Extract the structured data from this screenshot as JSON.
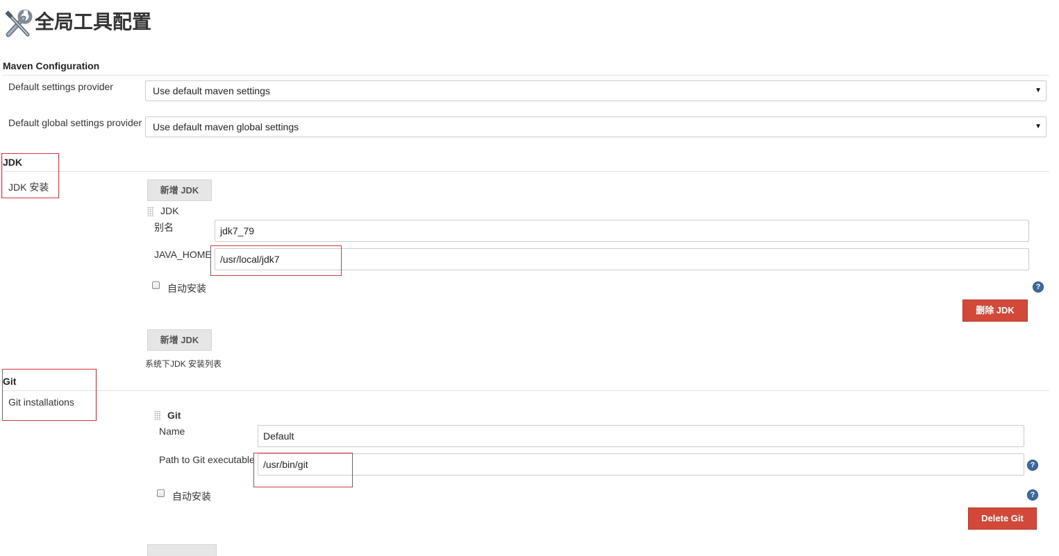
{
  "header": {
    "title": "全局工具配置"
  },
  "maven": {
    "heading": "Maven Configuration",
    "settings_label": "Default settings provider",
    "settings_value": "Use default maven settings",
    "global_label": "Default global settings provider",
    "global_value": "Use default maven global settings"
  },
  "jdk": {
    "heading": "JDK",
    "installations_label": "JDK 安装",
    "add_button": "新增 JDK",
    "item_title": "JDK",
    "alias_label": "别名",
    "alias_value": "jdk7_79",
    "java_home_label": "JAVA_HOME",
    "java_home_value": "/usr/local/jdk7",
    "auto_install_label": "自动安装",
    "delete_button": "删除 JDK",
    "add_button_2": "新增 JDK",
    "list_description": "系统下JDK 安装列表"
  },
  "git": {
    "heading": "Git",
    "installations_label": "Git installations",
    "item_title": "Git",
    "name_label": "Name",
    "name_value": "Default",
    "path_label": "Path to Git executable",
    "path_value": "/usr/bin/git",
    "auto_install_label": "自动安装",
    "delete_button": "Delete Git"
  },
  "icons": {
    "tools": "tools-icon",
    "help": "help-icon",
    "caret": "chevron-down-icon",
    "drag": "drag-handle-icon"
  },
  "colors": {
    "delete_button": "#d24939",
    "highlight_box": "#d9343a",
    "help_icon": "#3b6aa0"
  }
}
